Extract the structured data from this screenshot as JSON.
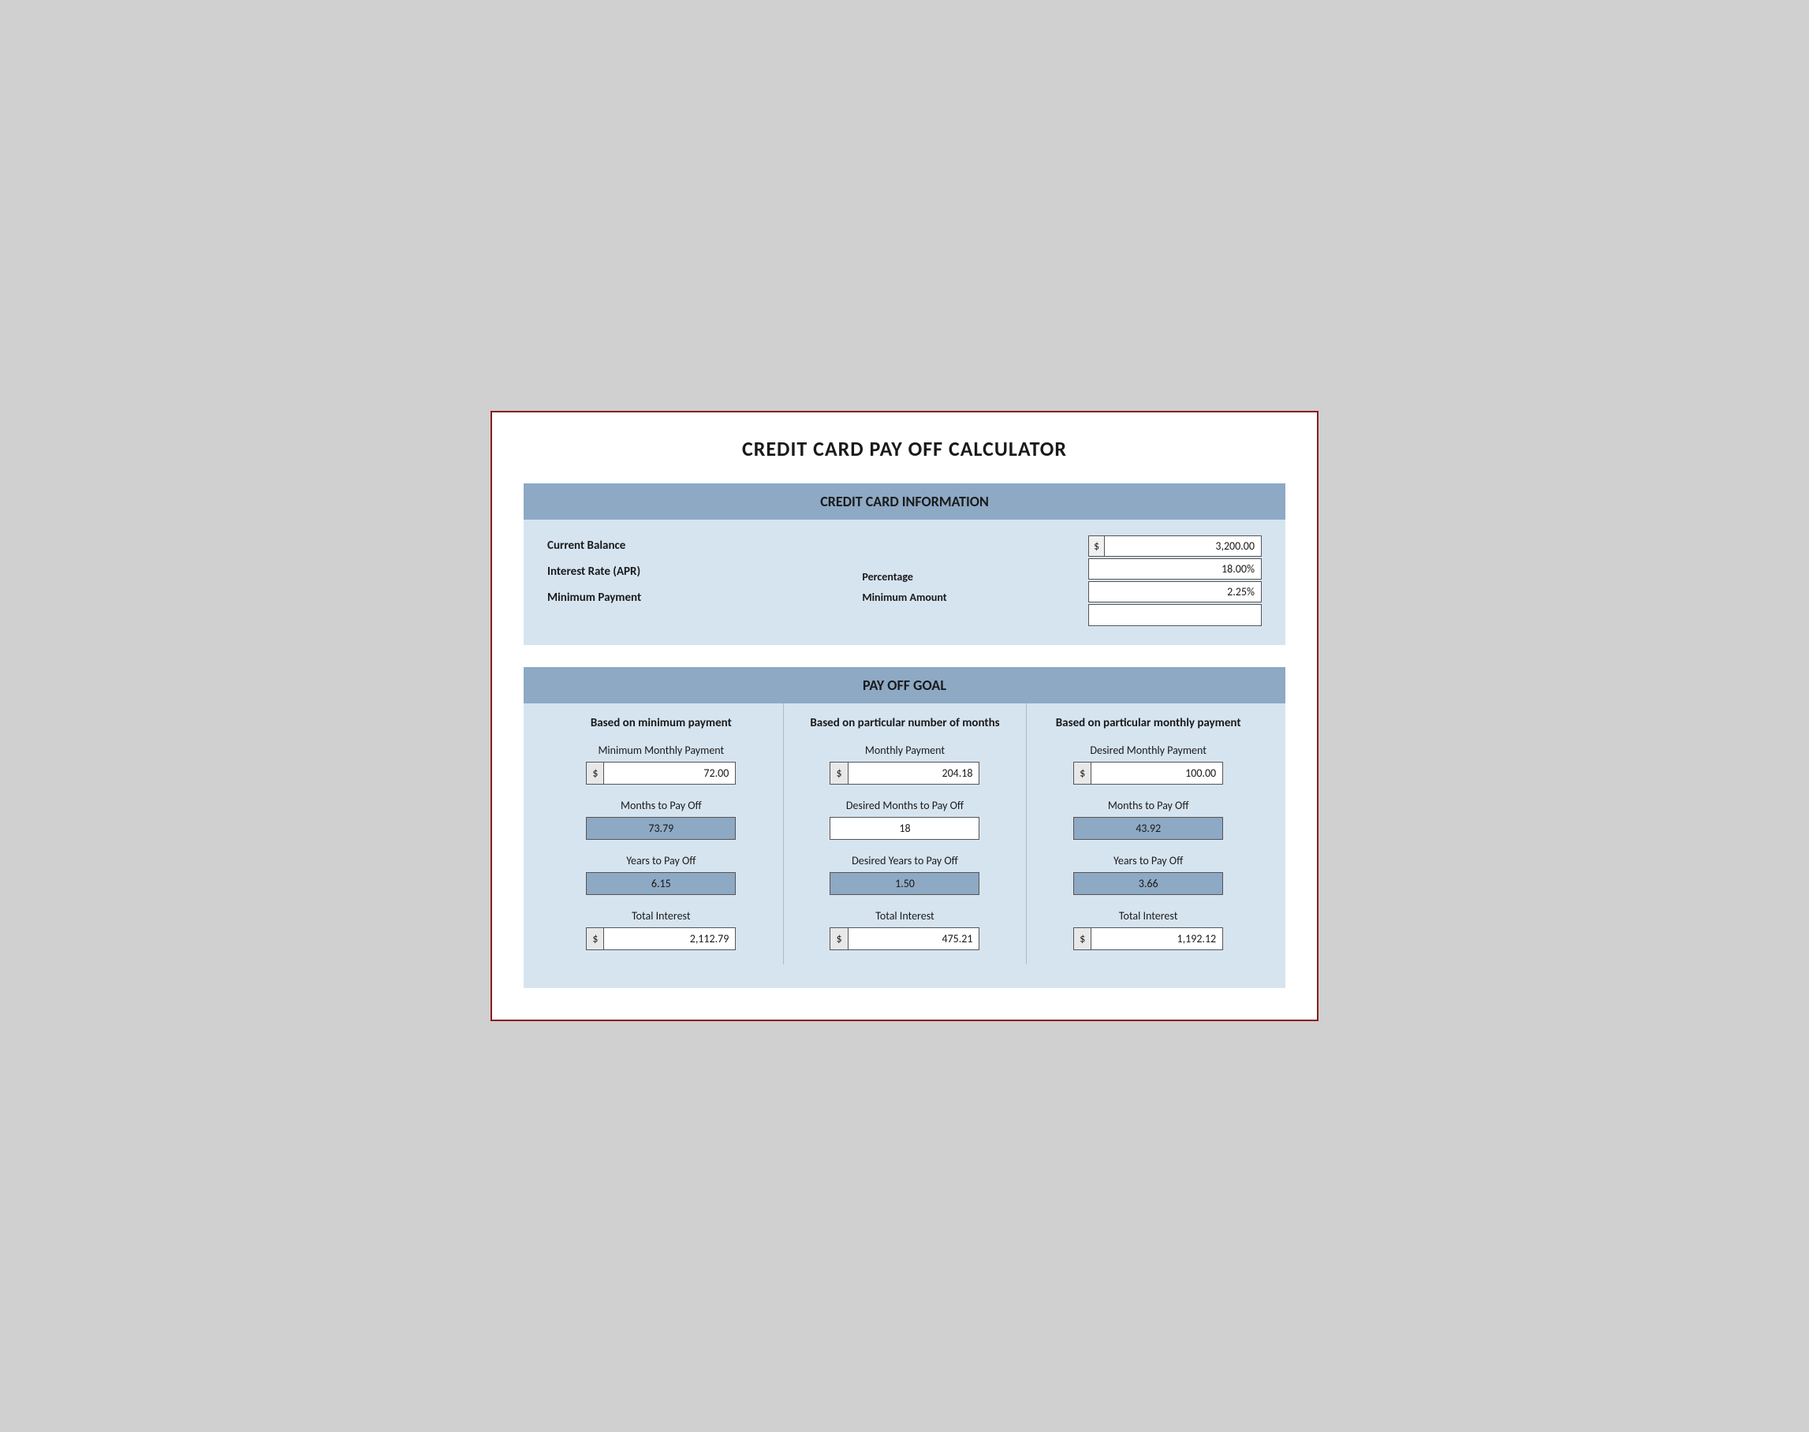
{
  "title": "CREDIT CARD PAY OFF CALCULATOR",
  "cc_info": {
    "header": "CREDIT CARD INFORMATION",
    "labels": {
      "balance": "Current Balance",
      "interest": "Interest Rate (APR)",
      "minimum": "Minimum Payment"
    },
    "middle_labels": {
      "percentage": "Percentage",
      "minimum_amount": "Minimum Amount"
    },
    "values": {
      "balance_dollar": "$",
      "balance_amount": "3,200.00",
      "interest_rate": "18.00%",
      "min_pct": "2.25%",
      "min_amount": ""
    }
  },
  "payoff": {
    "header": "PAY OFF GOAL",
    "col1": {
      "header": "Based on minimum payment",
      "label1": "Minimum Monthly Payment",
      "value1_dollar": "$",
      "value1": "72.00",
      "label2": "Months to Pay Off",
      "value2": "73.79",
      "label3": "Years to Pay Off",
      "value3": "6.15",
      "label4": "Total Interest",
      "value4_dollar": "$",
      "value4": "2,112.79"
    },
    "col2": {
      "header": "Based on particular number of months",
      "label1": "Monthly Payment",
      "value1_dollar": "$",
      "value1": "204.18",
      "label2": "Desired Months to Pay Off",
      "value2": "18",
      "label3": "Desired Years to Pay Off",
      "value3": "1.50",
      "label4": "Total Interest",
      "value4_dollar": "$",
      "value4": "475.21"
    },
    "col3": {
      "header": "Based on particular monthly payment",
      "label1": "Desired Monthly Payment",
      "value1_dollar": "$",
      "value1": "100.00",
      "label2": "Months to Pay Off",
      "value2": "43.92",
      "label3": "Years to Pay Off",
      "value3": "3.66",
      "label4": "Total Interest",
      "value4_dollar": "$",
      "value4": "1,192.12"
    }
  }
}
